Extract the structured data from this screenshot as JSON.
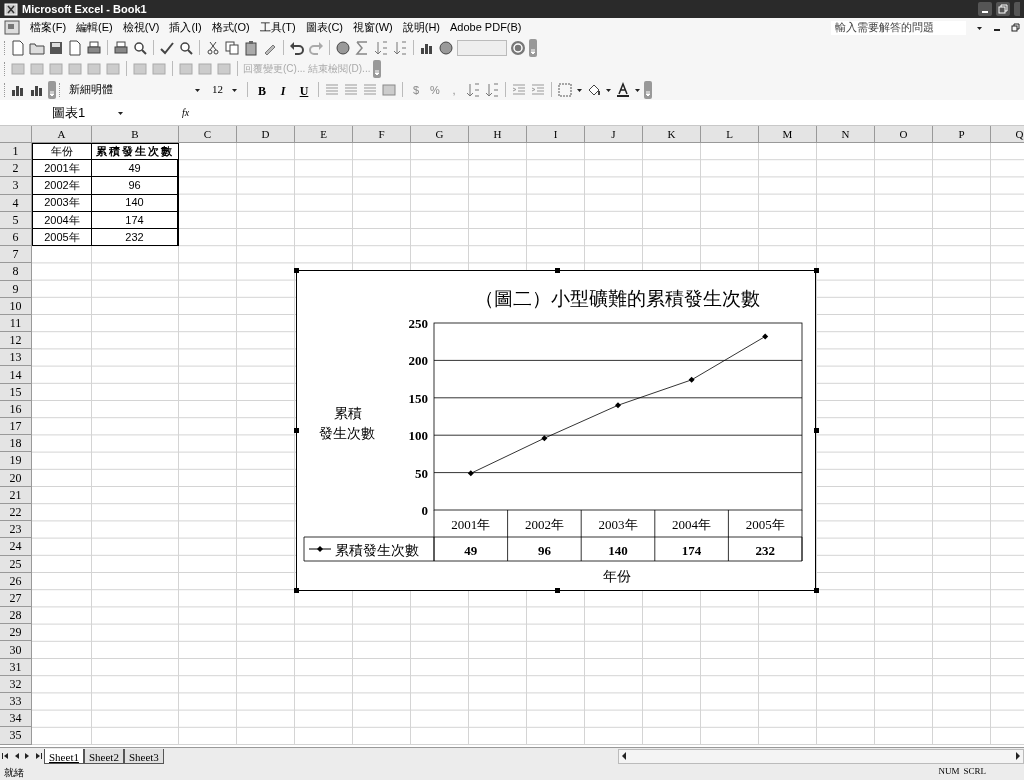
{
  "window": {
    "title": "Microsoft Excel - Book1"
  },
  "menu": {
    "items": [
      "檔案(F)",
      "編輯(E)",
      "檢視(V)",
      "插入(I)",
      "格式(O)",
      "工具(T)",
      "圖表(C)",
      "視窗(W)",
      "說明(H)",
      "Adobe PDF(B)"
    ],
    "help_box": {
      "placeholder": "輸入需要解答的問題"
    }
  },
  "review_toolbar": [
    {
      "label": "回覆變更(C)...",
      "disabled": true
    },
    {
      "label": "結束檢閱(D)...",
      "disabled": true
    }
  ],
  "format_toolbar": {
    "font": "新細明體",
    "size": "12",
    "style_buttons": [
      "B",
      "I",
      "U"
    ],
    "number_buttons": [
      "$",
      "%",
      ","
    ]
  },
  "formula_bar": {
    "name_box": "圖表1",
    "function_label": "fx"
  },
  "sheet": {
    "columns": [
      "A",
      "B",
      "C",
      "D",
      "E",
      "F",
      "G",
      "H",
      "I",
      "J",
      "K",
      "L",
      "M",
      "N",
      "O",
      "P",
      "Q"
    ],
    "row_numbers": [
      "1",
      "2",
      "3",
      "4",
      "5",
      "6",
      "7",
      "8",
      "9",
      "10",
      "11",
      "12",
      "13",
      "14",
      "15",
      "16",
      "17",
      "18",
      "19",
      "20",
      "21",
      "22",
      "23",
      "24",
      "25",
      "26",
      "27",
      "28",
      "29",
      "30",
      "31",
      "32",
      "33",
      "34",
      "35"
    ],
    "cells": [
      [
        "年份",
        "累積發生次數"
      ],
      [
        "2001年",
        "49"
      ],
      [
        "2002年",
        "96"
      ],
      [
        "2003年",
        "140"
      ],
      [
        "2004年",
        "174"
      ],
      [
        "2005年",
        "232"
      ]
    ]
  },
  "chart": {
    "chart_data": {
      "type": "line",
      "title": "（圖二）小型礦難的累積發生次數",
      "xlabel": "年份",
      "ylabel": "累積發生次數",
      "categories": [
        "2001年",
        "2002年",
        "2003年",
        "2004年",
        "2005年"
      ],
      "series": [
        {
          "name": "累積發生次數",
          "color": "#000000",
          "marker": "diamond",
          "values": [
            49,
            96,
            140,
            174,
            232
          ]
        }
      ],
      "value_labels": [
        "49",
        "96",
        "140",
        "174",
        "232"
      ],
      "grid": true,
      "ylim": [
        0,
        250
      ],
      "yticks": [
        0,
        50,
        100,
        150,
        200,
        250
      ]
    }
  },
  "sheet_tabs": [
    {
      "label": "Sheet1",
      "selected": true
    },
    {
      "label": "Sheet2",
      "selected": false
    },
    {
      "label": "Sheet3",
      "selected": false
    }
  ],
  "status_bar": {
    "text": "就緒",
    "indicators": [
      "NUM",
      "SCRL"
    ]
  }
}
